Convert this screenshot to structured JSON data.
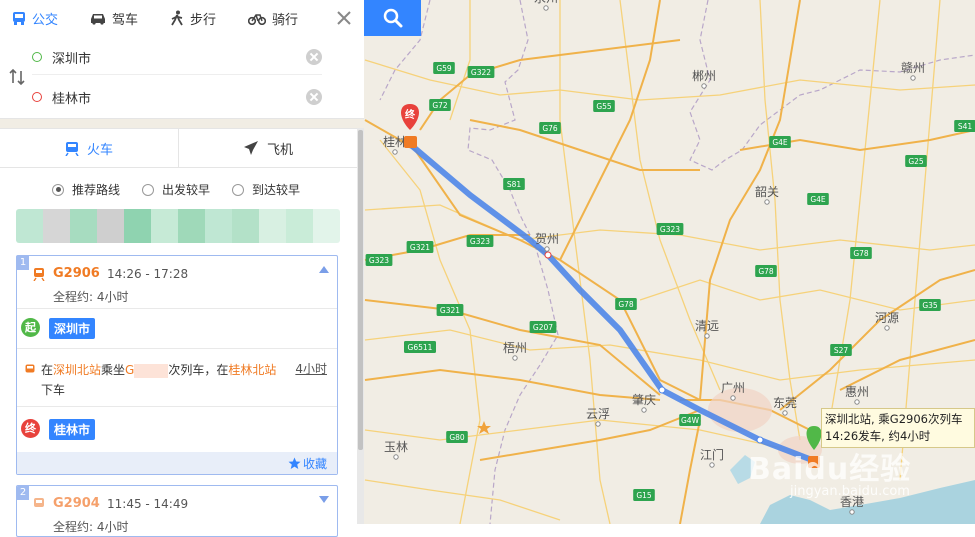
{
  "topbar": {
    "modes": [
      {
        "label": "公交",
        "icon": "bus-icon"
      },
      {
        "label": "驾车",
        "icon": "car-icon"
      },
      {
        "label": "步行",
        "icon": "walk-icon"
      },
      {
        "label": "骑行",
        "icon": "bike-icon"
      }
    ]
  },
  "inputs": {
    "origin": "深圳市",
    "destination": "桂林市"
  },
  "transport_tabs": [
    {
      "label": "火车",
      "icon": "train-icon"
    },
    {
      "label": "飞机",
      "icon": "plane-icon"
    }
  ],
  "sort_options": [
    "推荐路线",
    "出发较早",
    "到达较早"
  ],
  "route1": {
    "index": "1",
    "train": "G2906",
    "time": "14:26 - 17:28",
    "duration": "全程约: 4小时",
    "start_badge": "起",
    "start": "深圳市",
    "step_pre": "在",
    "board_station": "深圳北站",
    "step_mid1": "乘坐",
    "train_prefix": "G",
    "step_mid2": "次列车，在",
    "alight_station": "桂林北站",
    "step_end": "下车",
    "step_duration": "4小时",
    "end_badge": "终",
    "end": "桂林市",
    "fav": "收藏"
  },
  "route2": {
    "index": "2",
    "train": "G2904",
    "time": "11:45 - 14:49",
    "duration": "全程约: 4小时"
  },
  "map": {
    "cities": [
      "桂林",
      "贺州",
      "梧州",
      "肇庆",
      "广州",
      "东莞",
      "云浮",
      "江门",
      "清远",
      "韶关",
      "郴州",
      "赣州",
      "河源",
      "惠州",
      "香港",
      "玉林",
      "永州"
    ],
    "highways": [
      "G59",
      "G322",
      "G72",
      "G55",
      "G76",
      "G4E",
      "S41",
      "S81",
      "G323",
      "G321",
      "G78",
      "G207",
      "G6511",
      "G80",
      "G4W",
      "S27",
      "G35",
      "G15",
      "G25"
    ],
    "end_marker": "终",
    "tooltip_line1": "深圳北站, 乘G2906次列车",
    "tooltip_line2": "14:26发车, 约4小时",
    "watermark": "Baidu经验",
    "watermark_url": "jingyan.baidu.com",
    "colors": {
      "route": "#4f86e8",
      "accent": "#3385ff",
      "orange": "#f07b24",
      "highway_shield": "#2ea44f",
      "marker_red": "#e8423c",
      "marker_green": "#51b848"
    }
  }
}
